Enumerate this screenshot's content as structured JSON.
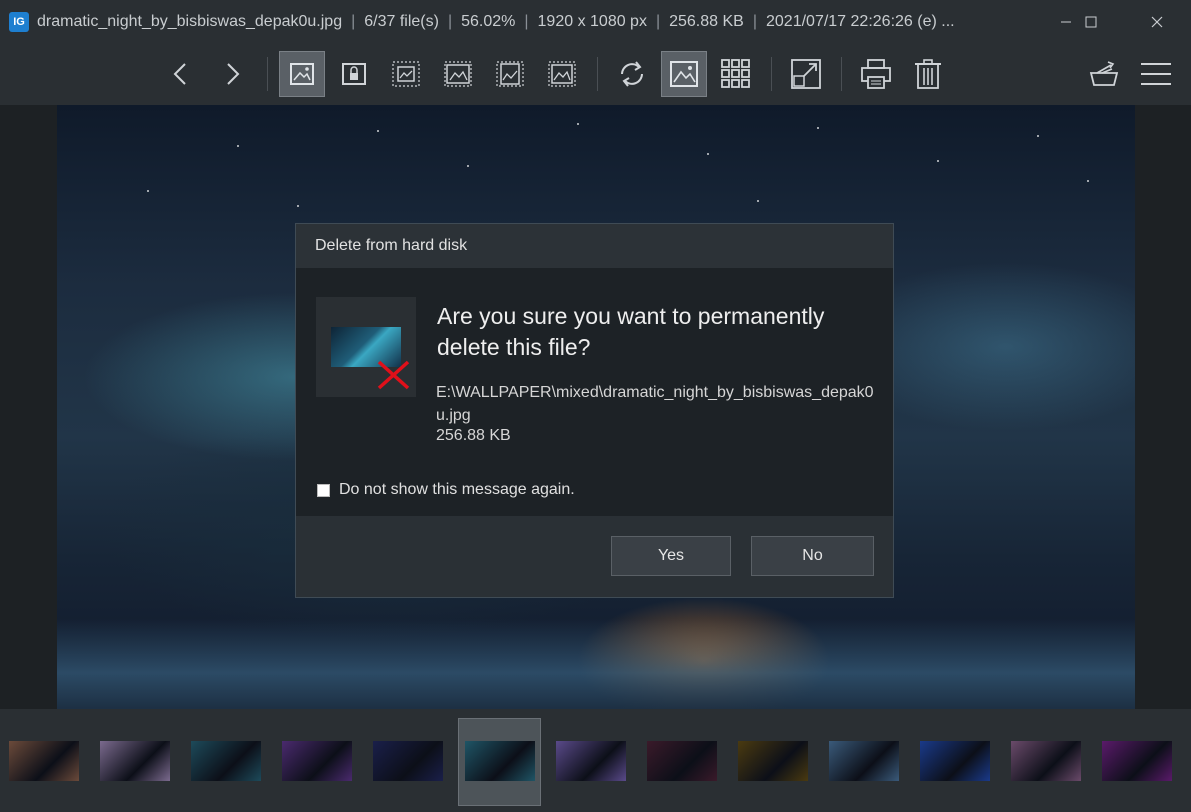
{
  "titlebar": {
    "app_icon_label": "IG",
    "filename": "dramatic_night_by_bisbiswas_depak0u.jpg",
    "file_index": "6/37 file(s)",
    "zoom": "56.02%",
    "dimensions": "1920 x 1080 px",
    "filesize": "256.88 KB",
    "datetime": "2021/07/17 22:26:26 (e)",
    "overflow": "...",
    "separator": "|",
    "icons": [
      "minimize-icon",
      "maximize-icon",
      "close-icon"
    ]
  },
  "toolbar": {
    "icons": [
      "prev-arrow-icon",
      "next-arrow-icon",
      "fit-image-icon",
      "lock-zoom-icon",
      "auto-zoom-icon",
      "scale-to-width-icon",
      "scale-to-height-icon",
      "scale-to-fill-icon",
      "rotate-icon",
      "image-view-icon",
      "thumbnail-grid-icon",
      "fullscreen-icon",
      "print-icon",
      "delete-icon",
      "open-with-icon",
      "menu-icon"
    ]
  },
  "dialog": {
    "title": "Delete from hard disk",
    "question": "Are you sure you want to permanently delete this file?",
    "path": "E:\\WALLPAPER\\mixed\\dramatic_night_by_bisbiswas_depak0u.jpg",
    "size": "256.88 KB",
    "checkbox_label": "Do not show this message again.",
    "checkbox_checked": false,
    "yes_label": "Yes",
    "no_label": "No"
  },
  "filmstrip": {
    "selected_index": 5,
    "thumb_colors": [
      "#6b4a3a",
      "#7b6a8e",
      "#1d4a5a",
      "#4a2a6e",
      "#1a1f4a",
      "#1f5566",
      "#5a4a8a",
      "#3a1a2a",
      "#4a3a10",
      "#3a5a7a",
      "#1a3a8a",
      "#6a4a6a",
      "#5a1a6a"
    ]
  },
  "colors": {
    "chrome": "#2a2f33",
    "dialog_bg": "#1d2226",
    "delete_x": "#e0101a"
  }
}
